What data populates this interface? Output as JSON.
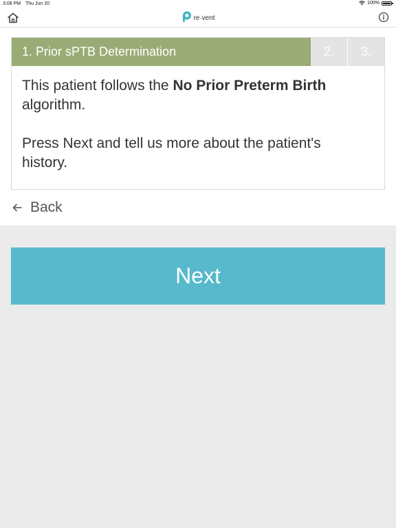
{
  "status_bar": {
    "time": "3:08 PM",
    "date": "Thu Jun 20",
    "battery": "100%",
    "wifi_icon": "wifi-icon",
    "battery_icon": "battery-icon"
  },
  "header": {
    "home_icon": "home-icon",
    "logo_text": "re·vent",
    "info_icon": "info-icon"
  },
  "steps": {
    "active_label": "1. Prior sPTB Determination",
    "step2_label": "2.",
    "step3_label": "3."
  },
  "message": {
    "line1_prefix": "This patient follows the ",
    "line1_bold": "No Prior Preterm Birth",
    "line1_suffix": " algorithm.",
    "line2": "Press Next and tell us more about the patient's history."
  },
  "back": {
    "label": "Back"
  },
  "next": {
    "label": "Next"
  },
  "colors": {
    "step_active": "#9aab75",
    "step_inactive": "#e4e4e4",
    "next_button": "#57b9cb",
    "logo_accent": "#3fb4c8"
  }
}
